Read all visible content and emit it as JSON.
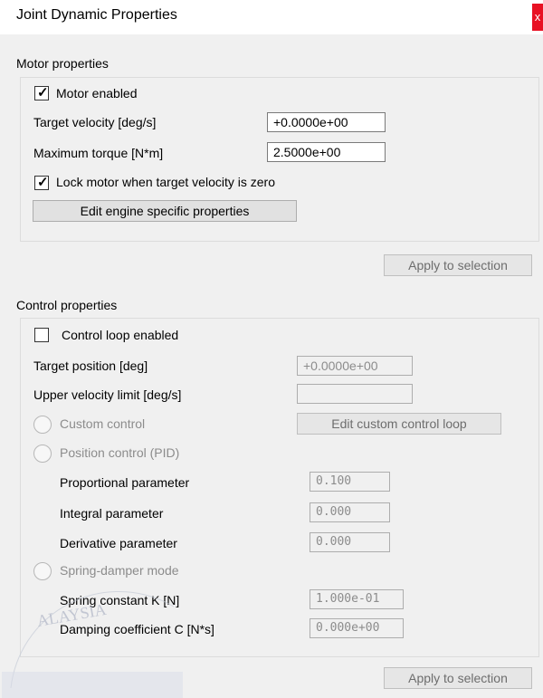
{
  "window": {
    "title": "Joint Dynamic Properties",
    "close_glyph": "x"
  },
  "motor": {
    "section_label": "Motor properties",
    "motor_enabled": {
      "label": "Motor enabled",
      "checked": true
    },
    "target_velocity": {
      "label": "Target velocity [deg/s]",
      "value": "+0.0000e+00"
    },
    "max_torque": {
      "label": "Maximum torque [N*m]",
      "value": "2.5000e+00"
    },
    "lock_motor": {
      "label": "Lock motor when target velocity is zero",
      "checked": true
    },
    "edit_engine_button": "Edit engine specific properties",
    "apply_button": "Apply to selection"
  },
  "control": {
    "section_label": "Control properties",
    "control_loop": {
      "label": "Control loop enabled",
      "checked": false
    },
    "target_position": {
      "label": "Target position [deg]",
      "value": "+0.0000e+00"
    },
    "upper_velocity": {
      "label": "Upper velocity limit [deg/s]",
      "value": ""
    },
    "custom_control": {
      "label": "Custom control"
    },
    "edit_custom_button": "Edit custom control loop",
    "position_control": {
      "label": "Position control (PID)"
    },
    "proportional": {
      "label": "Proportional parameter",
      "value": "0.100"
    },
    "integral": {
      "label": "Integral parameter",
      "value": "0.000"
    },
    "derivative": {
      "label": "Derivative parameter",
      "value": "0.000"
    },
    "spring_damper": {
      "label": "Spring-damper mode"
    },
    "spring_constant": {
      "label": "Spring constant K [N]",
      "value": "1.000e-01"
    },
    "damping": {
      "label": "Damping coefficient C [N*s]",
      "value": "0.000e+00"
    },
    "apply_button": "Apply to selection"
  },
  "watermark": {
    "text": "ALAYSIA"
  }
}
